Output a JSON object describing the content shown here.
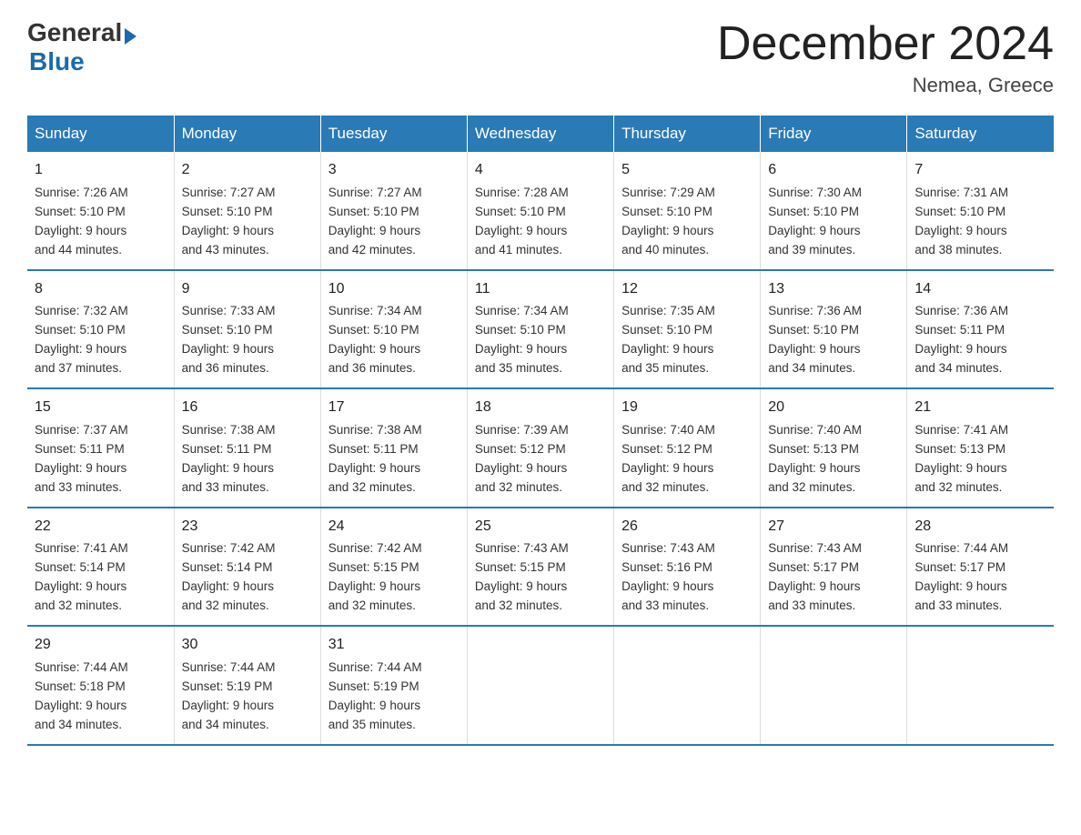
{
  "logo": {
    "general": "General",
    "blue": "Blue"
  },
  "title": "December 2024",
  "location": "Nemea, Greece",
  "days_of_week": [
    "Sunday",
    "Monday",
    "Tuesday",
    "Wednesday",
    "Thursday",
    "Friday",
    "Saturday"
  ],
  "weeks": [
    [
      {
        "day": "1",
        "sunrise": "7:26 AM",
        "sunset": "5:10 PM",
        "daylight": "9 hours and 44 minutes."
      },
      {
        "day": "2",
        "sunrise": "7:27 AM",
        "sunset": "5:10 PM",
        "daylight": "9 hours and 43 minutes."
      },
      {
        "day": "3",
        "sunrise": "7:27 AM",
        "sunset": "5:10 PM",
        "daylight": "9 hours and 42 minutes."
      },
      {
        "day": "4",
        "sunrise": "7:28 AM",
        "sunset": "5:10 PM",
        "daylight": "9 hours and 41 minutes."
      },
      {
        "day": "5",
        "sunrise": "7:29 AM",
        "sunset": "5:10 PM",
        "daylight": "9 hours and 40 minutes."
      },
      {
        "day": "6",
        "sunrise": "7:30 AM",
        "sunset": "5:10 PM",
        "daylight": "9 hours and 39 minutes."
      },
      {
        "day": "7",
        "sunrise": "7:31 AM",
        "sunset": "5:10 PM",
        "daylight": "9 hours and 38 minutes."
      }
    ],
    [
      {
        "day": "8",
        "sunrise": "7:32 AM",
        "sunset": "5:10 PM",
        "daylight": "9 hours and 37 minutes."
      },
      {
        "day": "9",
        "sunrise": "7:33 AM",
        "sunset": "5:10 PM",
        "daylight": "9 hours and 36 minutes."
      },
      {
        "day": "10",
        "sunrise": "7:34 AM",
        "sunset": "5:10 PM",
        "daylight": "9 hours and 36 minutes."
      },
      {
        "day": "11",
        "sunrise": "7:34 AM",
        "sunset": "5:10 PM",
        "daylight": "9 hours and 35 minutes."
      },
      {
        "day": "12",
        "sunrise": "7:35 AM",
        "sunset": "5:10 PM",
        "daylight": "9 hours and 35 minutes."
      },
      {
        "day": "13",
        "sunrise": "7:36 AM",
        "sunset": "5:10 PM",
        "daylight": "9 hours and 34 minutes."
      },
      {
        "day": "14",
        "sunrise": "7:36 AM",
        "sunset": "5:11 PM",
        "daylight": "9 hours and 34 minutes."
      }
    ],
    [
      {
        "day": "15",
        "sunrise": "7:37 AM",
        "sunset": "5:11 PM",
        "daylight": "9 hours and 33 minutes."
      },
      {
        "day": "16",
        "sunrise": "7:38 AM",
        "sunset": "5:11 PM",
        "daylight": "9 hours and 33 minutes."
      },
      {
        "day": "17",
        "sunrise": "7:38 AM",
        "sunset": "5:11 PM",
        "daylight": "9 hours and 32 minutes."
      },
      {
        "day": "18",
        "sunrise": "7:39 AM",
        "sunset": "5:12 PM",
        "daylight": "9 hours and 32 minutes."
      },
      {
        "day": "19",
        "sunrise": "7:40 AM",
        "sunset": "5:12 PM",
        "daylight": "9 hours and 32 minutes."
      },
      {
        "day": "20",
        "sunrise": "7:40 AM",
        "sunset": "5:13 PM",
        "daylight": "9 hours and 32 minutes."
      },
      {
        "day": "21",
        "sunrise": "7:41 AM",
        "sunset": "5:13 PM",
        "daylight": "9 hours and 32 minutes."
      }
    ],
    [
      {
        "day": "22",
        "sunrise": "7:41 AM",
        "sunset": "5:14 PM",
        "daylight": "9 hours and 32 minutes."
      },
      {
        "day": "23",
        "sunrise": "7:42 AM",
        "sunset": "5:14 PM",
        "daylight": "9 hours and 32 minutes."
      },
      {
        "day": "24",
        "sunrise": "7:42 AM",
        "sunset": "5:15 PM",
        "daylight": "9 hours and 32 minutes."
      },
      {
        "day": "25",
        "sunrise": "7:43 AM",
        "sunset": "5:15 PM",
        "daylight": "9 hours and 32 minutes."
      },
      {
        "day": "26",
        "sunrise": "7:43 AM",
        "sunset": "5:16 PM",
        "daylight": "9 hours and 33 minutes."
      },
      {
        "day": "27",
        "sunrise": "7:43 AM",
        "sunset": "5:17 PM",
        "daylight": "9 hours and 33 minutes."
      },
      {
        "day": "28",
        "sunrise": "7:44 AM",
        "sunset": "5:17 PM",
        "daylight": "9 hours and 33 minutes."
      }
    ],
    [
      {
        "day": "29",
        "sunrise": "7:44 AM",
        "sunset": "5:18 PM",
        "daylight": "9 hours and 34 minutes."
      },
      {
        "day": "30",
        "sunrise": "7:44 AM",
        "sunset": "5:19 PM",
        "daylight": "9 hours and 34 minutes."
      },
      {
        "day": "31",
        "sunrise": "7:44 AM",
        "sunset": "5:19 PM",
        "daylight": "9 hours and 35 minutes."
      },
      null,
      null,
      null,
      null
    ]
  ],
  "labels": {
    "sunrise": "Sunrise:",
    "sunset": "Sunset:",
    "daylight": "Daylight:"
  }
}
